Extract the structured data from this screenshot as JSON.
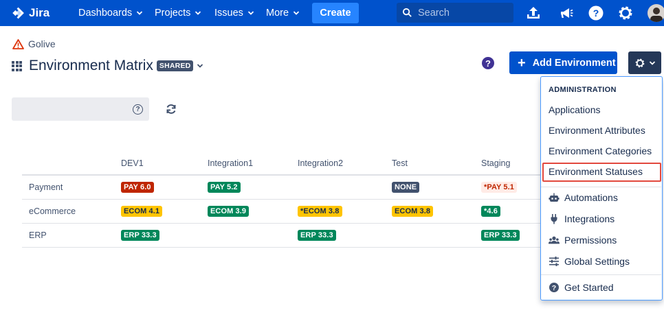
{
  "nav": {
    "logo_text": "Jira",
    "items": [
      "Dashboards",
      "Projects",
      "Issues",
      "More"
    ],
    "create_label": "Create",
    "search_placeholder": "Search"
  },
  "header": {
    "breadcrumb": "Golive",
    "title": "Environment Matrix",
    "shared_badge": "SHARED",
    "help_glyph": "?",
    "add_environment_label": "Add Environment"
  },
  "filter": {
    "value": "",
    "help_glyph": "?"
  },
  "matrix": {
    "columns": [
      "DEV1",
      "Integration1",
      "Integration2",
      "Test",
      "Staging"
    ],
    "rows": [
      {
        "name": "Payment",
        "cells": [
          {
            "text": "PAY 6.0",
            "status": "red"
          },
          {
            "text": "PAY 5.2",
            "status": "green"
          },
          {
            "text": "",
            "status": "none"
          },
          {
            "text": "NONE",
            "status": "gray"
          },
          {
            "text": "*PAY 5.1",
            "status": "red-light"
          }
        ]
      },
      {
        "name": "eCommerce",
        "cells": [
          {
            "text": "ECOM 4.1",
            "status": "yellow"
          },
          {
            "text": "ECOM 3.9",
            "status": "green"
          },
          {
            "text": "*ECOM 3.8",
            "status": "yellow"
          },
          {
            "text": "ECOM 3.8",
            "status": "yellow"
          },
          {
            "text": "*4.6",
            "status": "green"
          }
        ]
      },
      {
        "name": "ERP",
        "cells": [
          {
            "text": "ERP 33.3",
            "status": "green"
          },
          {
            "text": "",
            "status": "none"
          },
          {
            "text": "ERP 33.3",
            "status": "green"
          },
          {
            "text": "",
            "status": "none"
          },
          {
            "text": "ERP 33.3",
            "status": "green"
          }
        ]
      }
    ]
  },
  "dropdown": {
    "header": "ADMINISTRATION",
    "admin_items": [
      "Applications",
      "Environment Attributes",
      "Environment Categories",
      "Environment Statuses"
    ],
    "highlighted_item": "Environment Statuses",
    "tool_items": [
      {
        "label": "Automations",
        "icon": "robot-icon"
      },
      {
        "label": "Integrations",
        "icon": "plug-icon"
      },
      {
        "label": "Permissions",
        "icon": "users-icon"
      },
      {
        "label": "Global Settings",
        "icon": "sliders-icon"
      }
    ],
    "footer_item": {
      "label": "Get Started",
      "icon": "question-circle-icon"
    }
  },
  "colors": {
    "nav_bg": "#0052cc",
    "create_bg": "#2684ff",
    "status_red": "#bf2600",
    "status_green": "#00875a",
    "status_yellow": "#ffc400",
    "status_gray": "#42526e",
    "status_red_light": "#ffebe6",
    "highlight_border": "#e2483d",
    "dropdown_border": "#4c9aff"
  }
}
